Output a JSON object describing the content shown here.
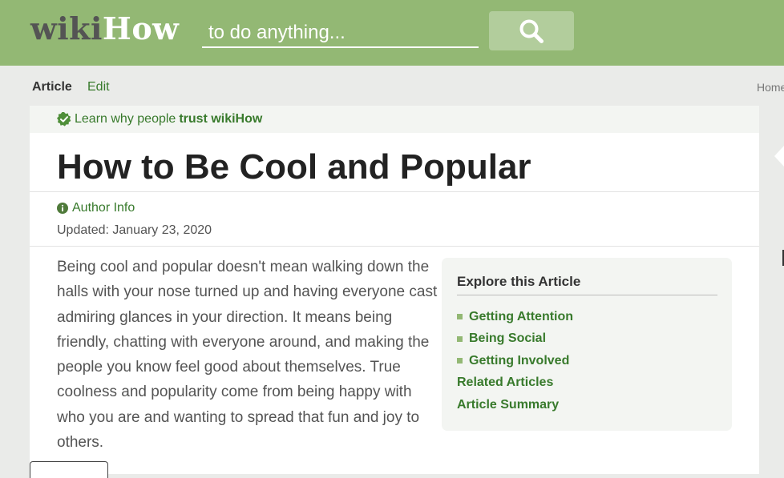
{
  "header": {
    "logo_wiki": "wiki",
    "logo_how": "How",
    "search_placeholder": "to do anything...",
    "search_icon": "search-icon",
    "bg_color": "#93b874"
  },
  "tabs": {
    "article": "Article",
    "edit": "Edit",
    "home": "Home"
  },
  "trust": {
    "prefix": "Learn why people",
    "strong": "trust wikiHow",
    "icon": "verified-check-icon"
  },
  "article": {
    "title": "How to Be Cool and Popular",
    "author_info": "Author Info",
    "updated": "Updated: January 23, 2020",
    "intro": "Being cool and popular doesn't mean walking down the halls with your nose turned up and having everyone cast admiring glances in your direction. It means being friendly, chatting with everyone around, and making the people you know feel good about themselves. True coolness and popularity come from being happy with who you are and wanting to spread that fun and joy to others."
  },
  "toc": {
    "title": "Explore this Article",
    "items": [
      {
        "label": "Getting Attention",
        "bullet": true
      },
      {
        "label": "Being Social",
        "bullet": true
      },
      {
        "label": "Getting Involved",
        "bullet": true
      },
      {
        "label": "Related Articles",
        "bullet": false
      },
      {
        "label": "Article Summary",
        "bullet": false
      }
    ]
  },
  "colors": {
    "link_green": "#387a2c",
    "accent_green": "#93b874"
  }
}
